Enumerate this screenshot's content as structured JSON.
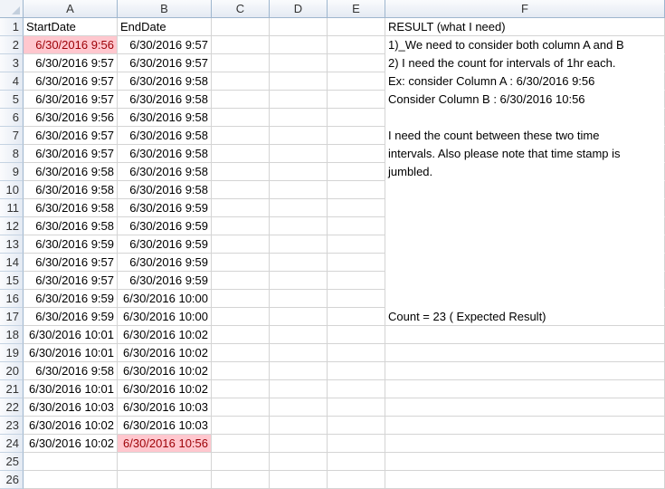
{
  "columns": [
    "A",
    "B",
    "C",
    "D",
    "E",
    "F"
  ],
  "rows": [
    {
      "num": "1",
      "a": "StartDate",
      "b": "EndDate",
      "f": "RESULT (what I need)"
    },
    {
      "num": "2",
      "a": "6/30/2016 9:56",
      "b": "6/30/2016 9:57",
      "f": "1)_We need to consider both column A and B"
    },
    {
      "num": "3",
      "a": "6/30/2016 9:57",
      "b": "6/30/2016 9:57",
      "f": "2) I need the count for intervals of 1hr each."
    },
    {
      "num": "4",
      "a": "6/30/2016 9:57",
      "b": "6/30/2016 9:58",
      "f": "Ex: consider Column A : 6/30/2016 9:56"
    },
    {
      "num": "5",
      "a": "6/30/2016 9:57",
      "b": "6/30/2016 9:58",
      "f": "      Consider Column B : 6/30/2016 10:56"
    },
    {
      "num": "6",
      "a": "6/30/2016 9:56",
      "b": "6/30/2016 9:58",
      "f": ""
    },
    {
      "num": "7",
      "a": "6/30/2016 9:57",
      "b": "6/30/2016 9:58",
      "f": "I need the count between these two time"
    },
    {
      "num": "8",
      "a": "6/30/2016 9:57",
      "b": "6/30/2016 9:58",
      "f": "intervals. Also please note that time stamp is"
    },
    {
      "num": "9",
      "a": "6/30/2016 9:58",
      "b": "6/30/2016 9:58",
      "f": "jumbled."
    },
    {
      "num": "10",
      "a": "6/30/2016 9:58",
      "b": "6/30/2016 9:58",
      "f": ""
    },
    {
      "num": "11",
      "a": "6/30/2016 9:58",
      "b": "6/30/2016 9:59",
      "f": ""
    },
    {
      "num": "12",
      "a": "6/30/2016 9:58",
      "b": "6/30/2016 9:59",
      "f": ""
    },
    {
      "num": "13",
      "a": "6/30/2016 9:59",
      "b": "6/30/2016 9:59",
      "f": ""
    },
    {
      "num": "14",
      "a": "6/30/2016 9:57",
      "b": "6/30/2016 9:59",
      "f": ""
    },
    {
      "num": "15",
      "a": "6/30/2016 9:57",
      "b": "6/30/2016 9:59",
      "f": ""
    },
    {
      "num": "16",
      "a": "6/30/2016 9:59",
      "b": "6/30/2016 10:00",
      "f": ""
    },
    {
      "num": "17",
      "a": "6/30/2016 9:59",
      "b": "6/30/2016 10:00",
      "f": "Count = 23 ( Expected Result)"
    },
    {
      "num": "18",
      "a": "6/30/2016 10:01",
      "b": "6/30/2016 10:02",
      "f": ""
    },
    {
      "num": "19",
      "a": "6/30/2016 10:01",
      "b": "6/30/2016 10:02",
      "f": ""
    },
    {
      "num": "20",
      "a": "6/30/2016 9:58",
      "b": "6/30/2016 10:02",
      "f": ""
    },
    {
      "num": "21",
      "a": "6/30/2016 10:01",
      "b": "6/30/2016 10:02",
      "f": ""
    },
    {
      "num": "22",
      "a": "6/30/2016 10:03",
      "b": "6/30/2016 10:03",
      "f": ""
    },
    {
      "num": "23",
      "a": "6/30/2016 10:02",
      "b": "6/30/2016 10:03",
      "f": ""
    },
    {
      "num": "24",
      "a": "6/30/2016 10:02",
      "b": "6/30/2016 10:56",
      "f": ""
    },
    {
      "num": "25",
      "a": "",
      "b": "",
      "f": ""
    },
    {
      "num": "26",
      "a": "",
      "b": "",
      "f": ""
    }
  ],
  "highlight": {
    "fill": "#ffc7ce",
    "text": "#9c0006",
    "cells": [
      "A2",
      "B24"
    ]
  },
  "colors": {
    "header_bg": "#e4eaf3",
    "header_border": "#9eb6ce",
    "gridline": "#d4d4d4"
  }
}
